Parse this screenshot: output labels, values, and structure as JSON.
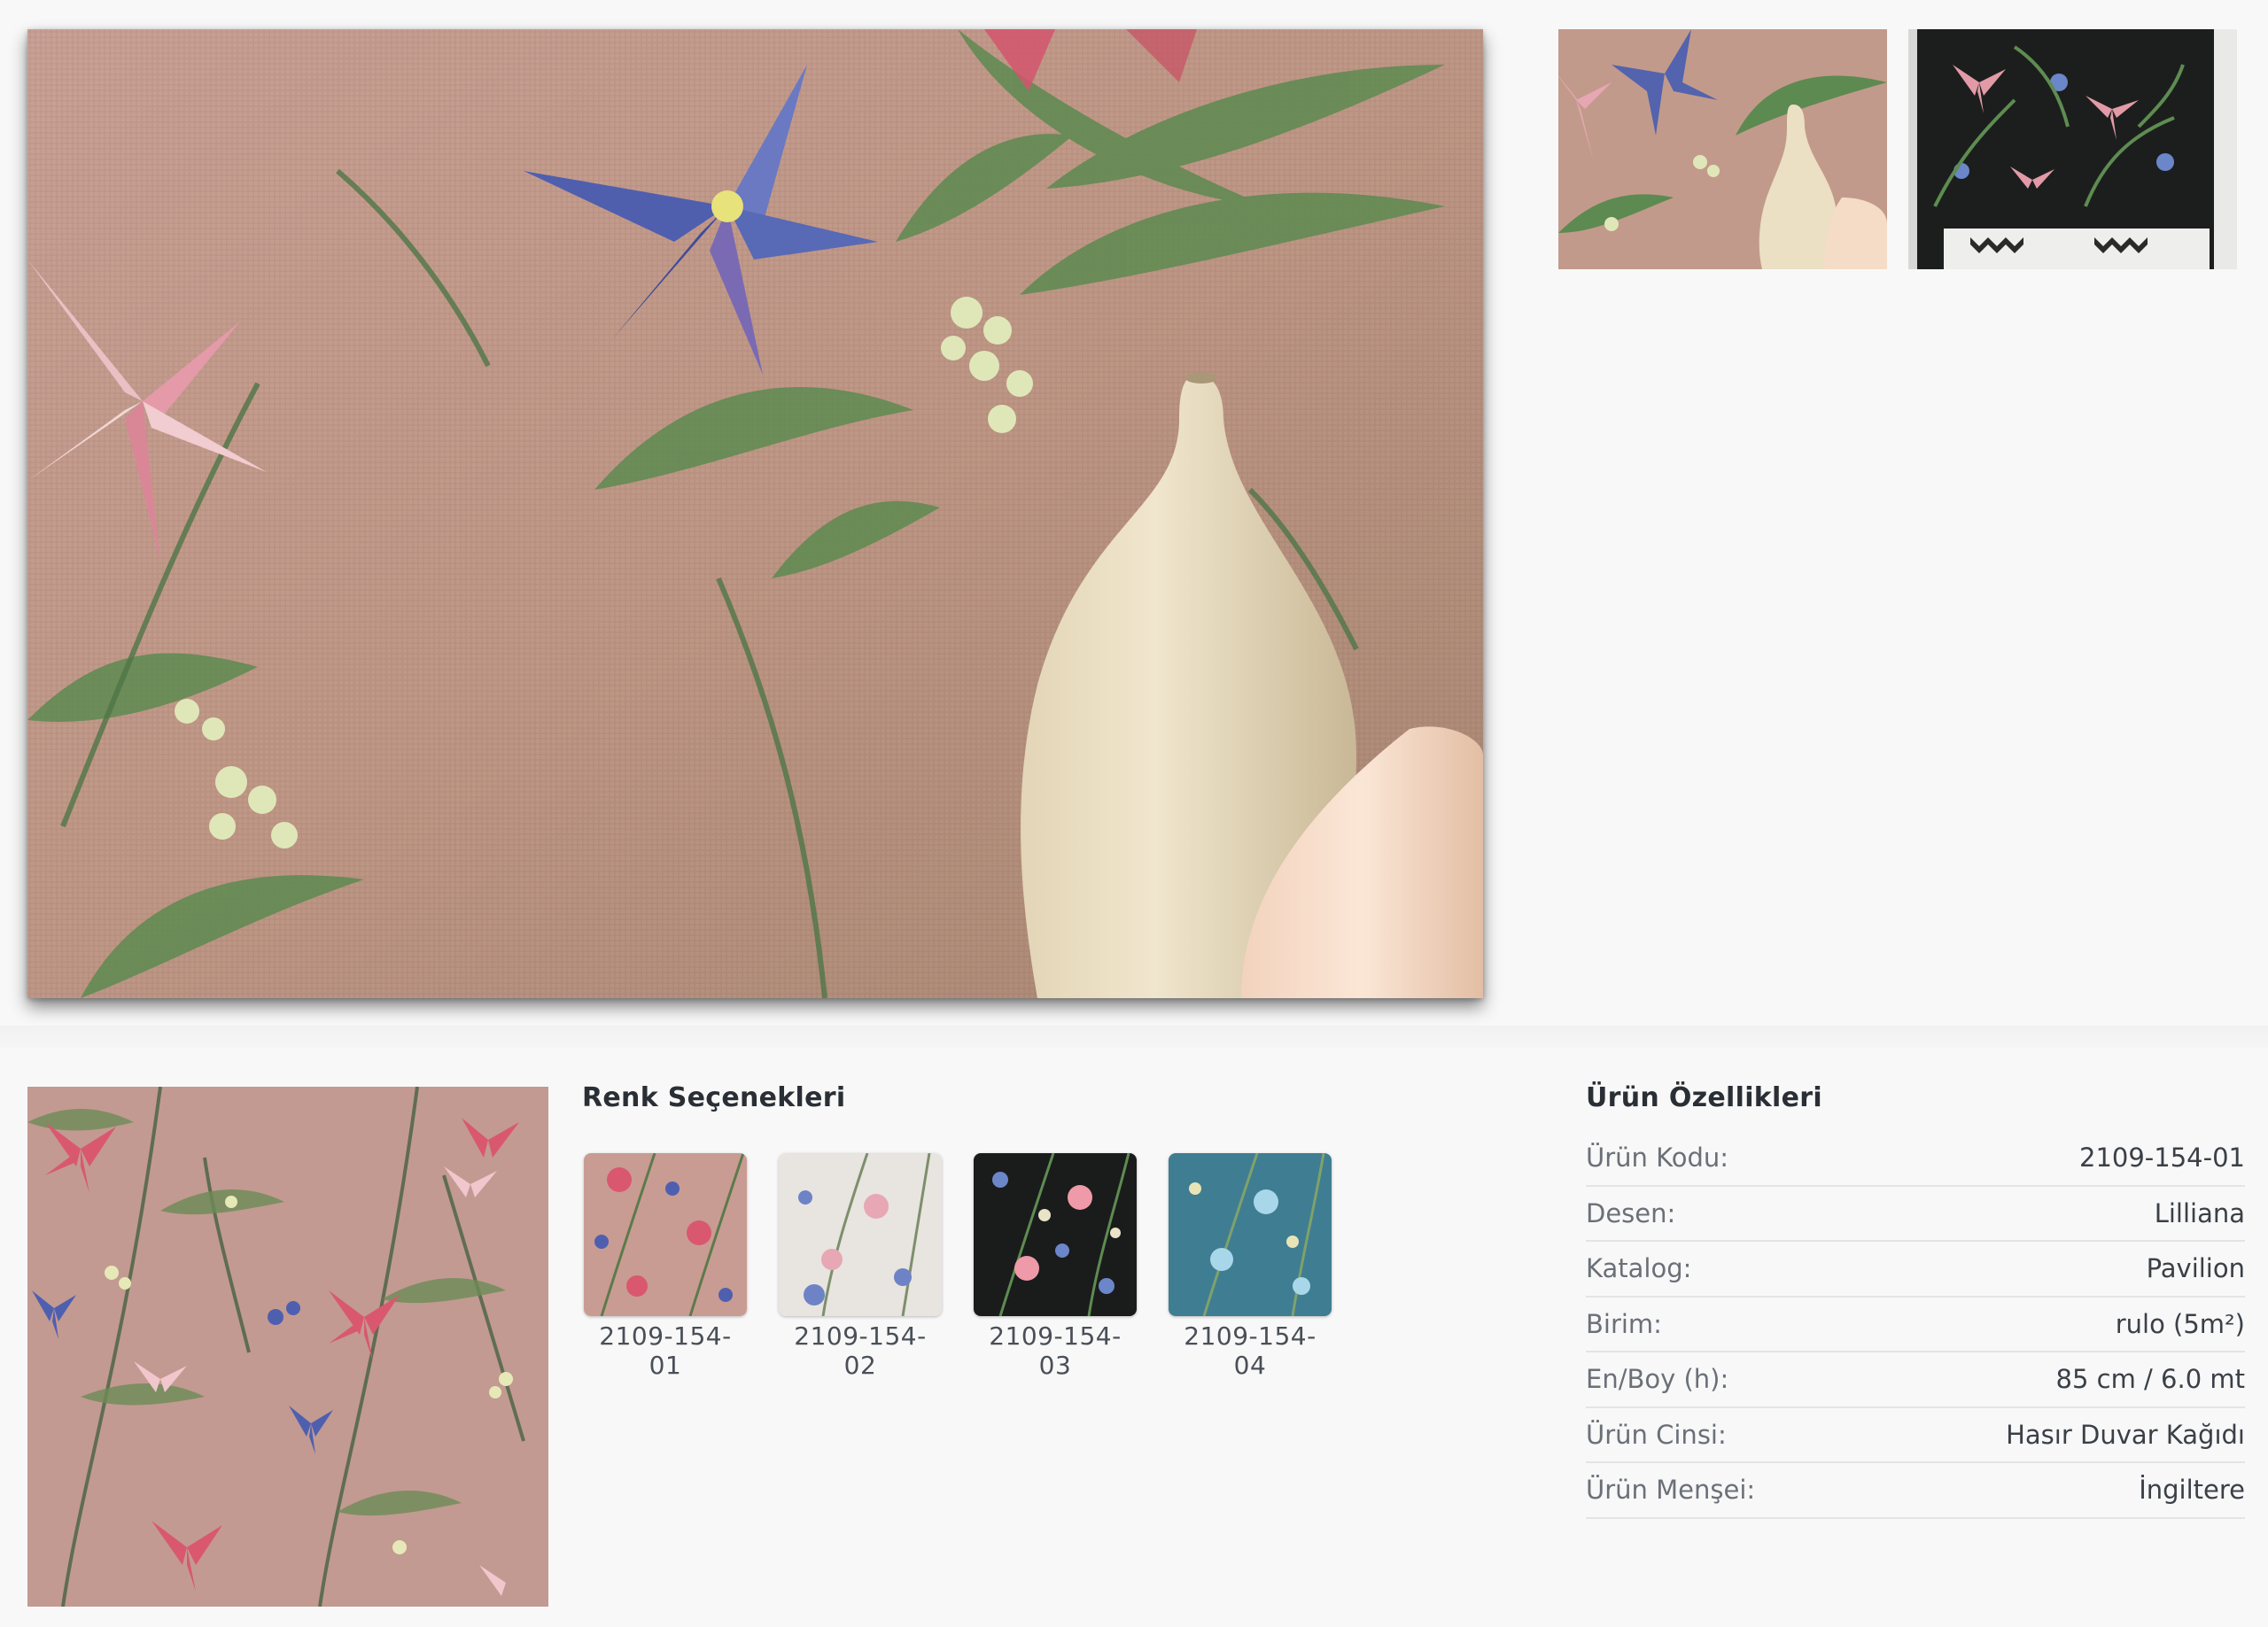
{
  "gallery": {
    "main_image": "wallpaper-room-photo",
    "thumbnails": [
      {
        "name": "thumb-pink-vase"
      },
      {
        "name": "thumb-black-bedroom"
      }
    ]
  },
  "color_options": {
    "heading": "Renk Seçenekleri",
    "items": [
      {
        "code": "2109-154-01",
        "bg": "#c89c93"
      },
      {
        "code": "2109-154-02",
        "bg": "#e8e4df"
      },
      {
        "code": "2109-154-03",
        "bg": "#1a1c1c"
      },
      {
        "code": "2109-154-04",
        "bg": "#3f7d92"
      }
    ]
  },
  "specs": {
    "heading": "Ürün Özellikleri",
    "rows": [
      {
        "key": "Ürün Kodu:",
        "value": "2109-154-01"
      },
      {
        "key": "Desen:",
        "value": "Lilliana"
      },
      {
        "key": "Katalog:",
        "value": "Pavilion"
      },
      {
        "key": "Birim:",
        "value": "rulo (5m²)"
      },
      {
        "key": "En/Boy (h):",
        "value": "85 cm / 6.0 mt"
      },
      {
        "key": "Ürün Cinsi:",
        "value": "Hasır Duvar Kağıdı"
      },
      {
        "key": "Ürün Menşei:",
        "value": "İngiltere"
      }
    ]
  },
  "colors": {
    "wall": "#c19a8a",
    "vase": "#ece1c8",
    "leaf": "#5f8a4e",
    "blue_flower": "#5668b3",
    "pink_flower": "#e9a3b0"
  }
}
